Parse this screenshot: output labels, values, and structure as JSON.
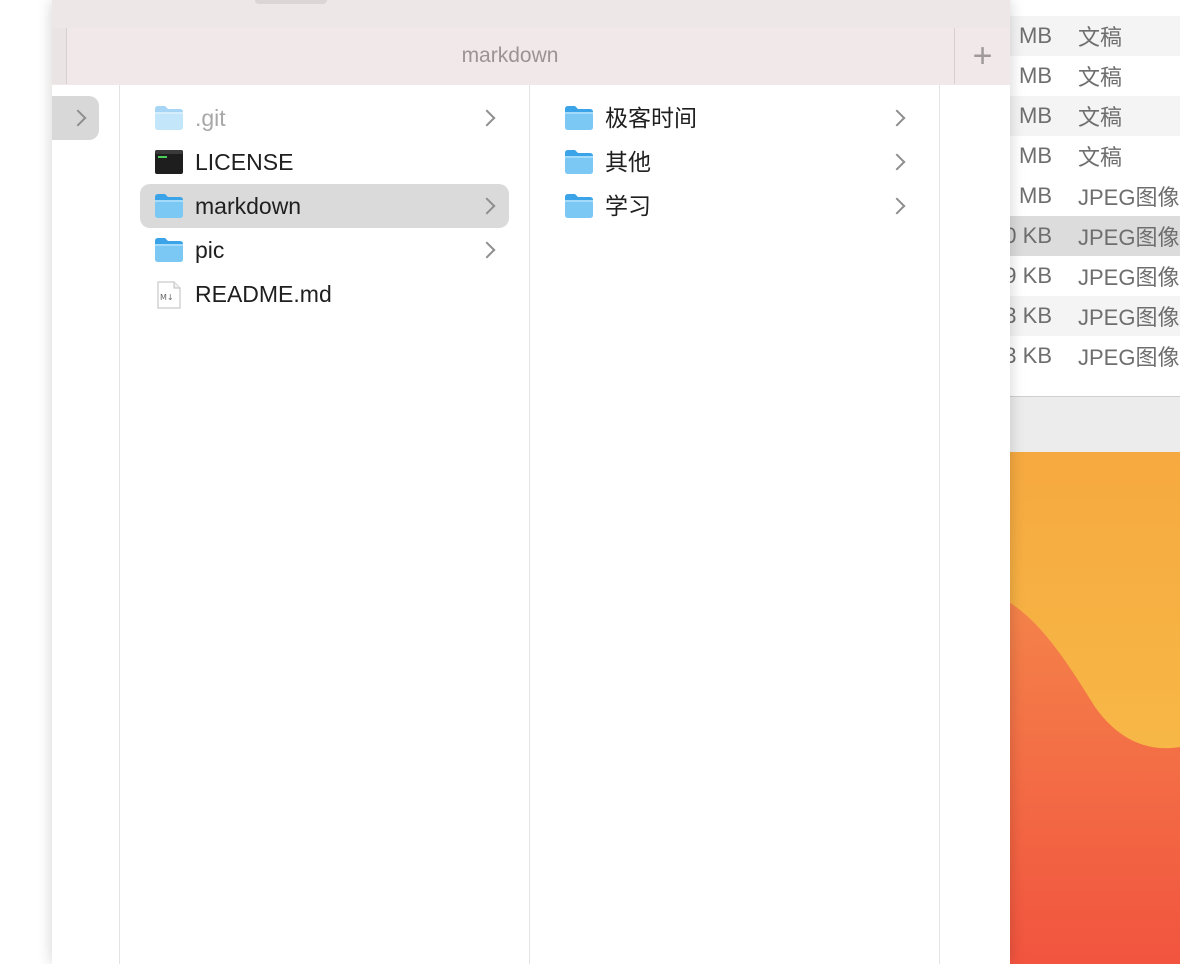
{
  "finder": {
    "tab_title": "markdown",
    "add_tab_label": "+",
    "column1": [
      {
        "name": ".git",
        "kind": "folder",
        "dimmed": true,
        "has_children": true,
        "selected": false
      },
      {
        "name": "LICENSE",
        "kind": "terminal-file",
        "dimmed": false,
        "has_children": false,
        "selected": false
      },
      {
        "name": "markdown",
        "kind": "folder",
        "dimmed": false,
        "has_children": true,
        "selected": true
      },
      {
        "name": "pic",
        "kind": "folder",
        "dimmed": false,
        "has_children": true,
        "selected": false
      },
      {
        "name": "README.md",
        "kind": "markdown-file",
        "dimmed": false,
        "has_children": false,
        "selected": false
      }
    ],
    "column2": [
      {
        "name": "极客时间",
        "kind": "folder",
        "dimmed": false,
        "has_children": true,
        "selected": false
      },
      {
        "name": "其他",
        "kind": "folder",
        "dimmed": false,
        "has_children": true,
        "selected": false
      },
      {
        "name": "学习",
        "kind": "folder",
        "dimmed": false,
        "has_children": true,
        "selected": false
      }
    ]
  },
  "background_window": {
    "rows": [
      {
        "size": "MB",
        "kind": "文稿",
        "alt": true
      },
      {
        "size": "MB",
        "kind": "文稿",
        "alt": false
      },
      {
        "size": "MB",
        "kind": "文稿",
        "alt": true
      },
      {
        "size": "MB",
        "kind": "文稿",
        "alt": false
      },
      {
        "size": "MB",
        "kind": "JPEG图像",
        "alt": false
      },
      {
        "size": "0 KB",
        "kind": "JPEG图像",
        "alt": false,
        "selected": true
      },
      {
        "size": "9 KB",
        "kind": "JPEG图像",
        "alt": false
      },
      {
        "size": "3 KB",
        "kind": "JPEG图像",
        "alt": true
      },
      {
        "size": "3 KB",
        "kind": "JPEG图像",
        "alt": false
      }
    ]
  },
  "colors": {
    "folder_light": "#7cc8f5",
    "folder_dark": "#3ba4e9",
    "selection": "#dadada",
    "titlebar": "#f1e9e9",
    "wallpaper_yellow": "#f7b541",
    "wallpaper_red": "#f25c45"
  }
}
